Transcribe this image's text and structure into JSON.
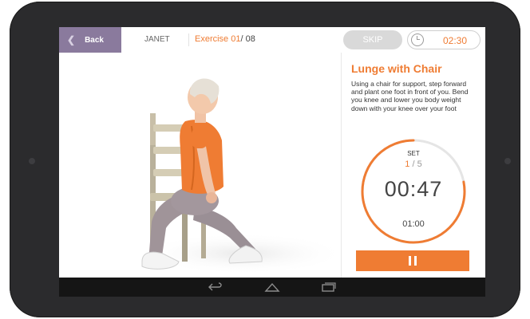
{
  "header": {
    "back_label": "Back",
    "user_name": "JANET",
    "exercise_prefix": "Exercise",
    "exercise_current": "01",
    "exercise_total": "/ 08",
    "skip_label": "SKIP",
    "session_time": "02:30"
  },
  "exercise": {
    "title": "Lunge with Chair",
    "description": "Using a chair for support, step forward and plant one foot in front of you. Bend you knee and lower you body weight down with your knee over your foot"
  },
  "timer": {
    "set_label": "SET",
    "set_current": "1",
    "set_total": "/ 5",
    "countdown": "00:47",
    "total": "01:00",
    "progress": 0.78
  },
  "colors": {
    "accent": "#ef7c33",
    "back_bg": "#8a7a9d",
    "skip_bg": "#d9d9d9",
    "device": "#2b2b2d"
  },
  "icons": {
    "back": "chevron-left-icon",
    "clock": "clock-icon",
    "pause": "pause-icon",
    "nav_back": "nav-back-icon",
    "nav_home": "nav-home-icon",
    "nav_recent": "nav-recent-icon"
  }
}
